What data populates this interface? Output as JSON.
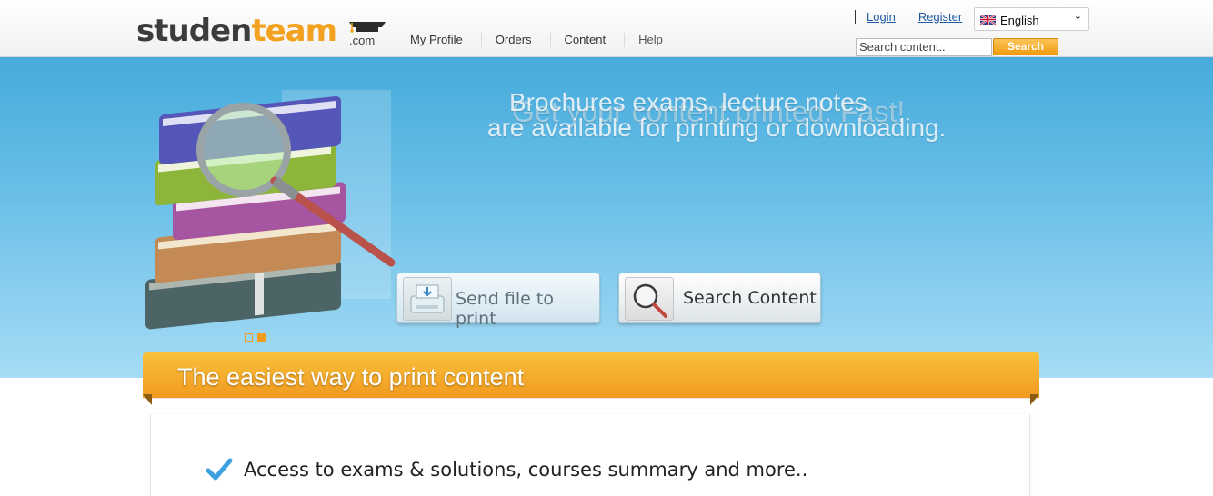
{
  "brand": {
    "part1": "studen",
    "part2": "team",
    "suffix": ".com"
  },
  "nav": [
    "My Profile",
    "Orders",
    "Content",
    "Help"
  ],
  "auth": {
    "login": "Login",
    "register": "Register"
  },
  "language": {
    "selected": "English",
    "icon": "uk-flag-icon"
  },
  "search": {
    "placeholder": "Search content..",
    "value": "Search content..",
    "button": "Search"
  },
  "hero": {
    "line1": "Brochures exams, lecture notes",
    "line2": "are available for printing or downloading.",
    "overlay": "Get your content printed. Fast!",
    "cta_send": "Send file to print",
    "cta_search": "Search Content",
    "slides": 2,
    "active_slide": 2
  },
  "section": {
    "title": "The easiest way to print content",
    "features": [
      "Access to exams & solutions, courses summary and more.."
    ]
  },
  "colors": {
    "accent": "#f3a21f",
    "hero_blue": "#46abdc",
    "link": "#1e5aa5"
  }
}
